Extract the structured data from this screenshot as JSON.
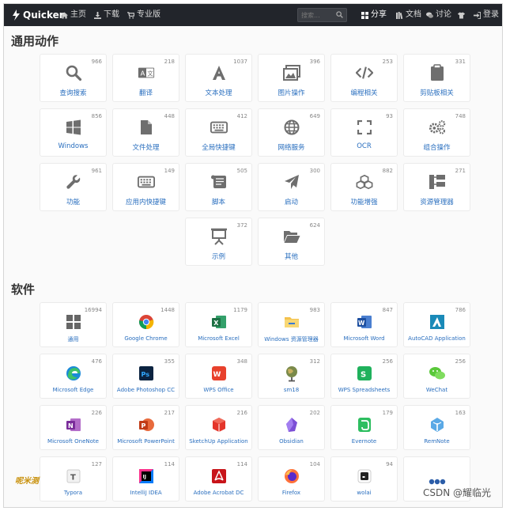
{
  "navbar": {
    "brand": "Quicker",
    "home": "主页",
    "download": "下载",
    "pro": "专业版",
    "search_placeholder": "搜索...",
    "share": "分享",
    "docs": "文档",
    "discuss": "讨论",
    "login": "登录"
  },
  "sections": {
    "actions_title": "通用动作",
    "software_title": "软件"
  },
  "actions": [
    {
      "label": "查询搜索",
      "count": "966",
      "icon": "search-icon"
    },
    {
      "label": "翻译",
      "count": "218",
      "icon": "translate-icon"
    },
    {
      "label": "文本处理",
      "count": "1037",
      "icon": "font-icon"
    },
    {
      "label": "图片操作",
      "count": "396",
      "icon": "image-icon"
    },
    {
      "label": "编程相关",
      "count": "253",
      "icon": "code-icon"
    },
    {
      "label": "剪贴板相关",
      "count": "331",
      "icon": "clipboard-icon"
    },
    {
      "label": "Windows",
      "count": "856",
      "icon": "windows-icon"
    },
    {
      "label": "文件处理",
      "count": "448",
      "icon": "file-icon"
    },
    {
      "label": "全局快捷键",
      "count": "412",
      "icon": "keyboard-icon"
    },
    {
      "label": "网络服务",
      "count": "649",
      "icon": "globe-icon"
    },
    {
      "label": "OCR",
      "count": "93",
      "icon": "ocr-scan-icon"
    },
    {
      "label": "组合操作",
      "count": "748",
      "icon": "cogs-icon"
    },
    {
      "label": "功能",
      "count": "961",
      "icon": "wrench-icon"
    },
    {
      "label": "应用内快捷键",
      "count": "149",
      "icon": "keyboard-icon"
    },
    {
      "label": "脚本",
      "count": "505",
      "icon": "scroll-icon"
    },
    {
      "label": "启动",
      "count": "300",
      "icon": "paper-plane-icon"
    },
    {
      "label": "功能增强",
      "count": "882",
      "icon": "cubes-icon"
    },
    {
      "label": "资源管理器",
      "count": "271",
      "icon": "sitemap-icon"
    },
    {
      "label": "示例",
      "count": "372",
      "icon": "presentation-icon"
    },
    {
      "label": "其他",
      "count": "624",
      "icon": "folder-open-icon"
    }
  ],
  "software": [
    {
      "label": "通用",
      "count": "16994",
      "icon": "grid-icon"
    },
    {
      "label": "Google Chrome",
      "count": "1448",
      "icon": "chrome-icon"
    },
    {
      "label": "Microsoft Excel",
      "count": "1179",
      "icon": "excel-icon"
    },
    {
      "label": "Windows 资源管理器",
      "count": "983",
      "icon": "explorer-icon"
    },
    {
      "label": "Microsoft Word",
      "count": "847",
      "icon": "word-icon"
    },
    {
      "label": "AutoCAD Application",
      "count": "786",
      "icon": "autocad-icon"
    },
    {
      "label": "Microsoft Edge",
      "count": "476",
      "icon": "edge-icon"
    },
    {
      "label": "Adobe Photoshop CC",
      "count": "355",
      "icon": "photoshop-icon"
    },
    {
      "label": "WPS Office",
      "count": "348",
      "icon": "wps-icon"
    },
    {
      "label": "sm18",
      "count": "312",
      "icon": "globe-stand-icon"
    },
    {
      "label": "WPS Spreadsheets",
      "count": "256",
      "icon": "wps-sheets-icon"
    },
    {
      "label": "WeChat",
      "count": "256",
      "icon": "wechat-icon"
    },
    {
      "label": "Microsoft OneNote",
      "count": "226",
      "icon": "onenote-icon"
    },
    {
      "label": "Microsoft PowerPoint",
      "count": "217",
      "icon": "powerpoint-icon"
    },
    {
      "label": "SketchUp Application",
      "count": "216",
      "icon": "sketchup-icon"
    },
    {
      "label": "Obsidian",
      "count": "202",
      "icon": "obsidian-icon"
    },
    {
      "label": "Evernote",
      "count": "179",
      "icon": "evernote-icon"
    },
    {
      "label": "RemNote",
      "count": "163",
      "icon": "remnote-icon"
    },
    {
      "label": "Typora",
      "count": "127",
      "icon": "typora-icon"
    },
    {
      "label": "IntelliJ IDEA",
      "count": "114",
      "icon": "intellij-icon"
    },
    {
      "label": "Adobe Acrobat DC",
      "count": "114",
      "icon": "acrobat-icon"
    },
    {
      "label": "Firefox",
      "count": "104",
      "icon": "firefox-icon"
    },
    {
      "label": "wolai",
      "count": "94",
      "icon": "wolai-icon"
    },
    {
      "label": "",
      "count": "",
      "icon": "more-dots-icon"
    }
  ],
  "watermark": "CSDN @耀临光",
  "stamp": "呢米测"
}
